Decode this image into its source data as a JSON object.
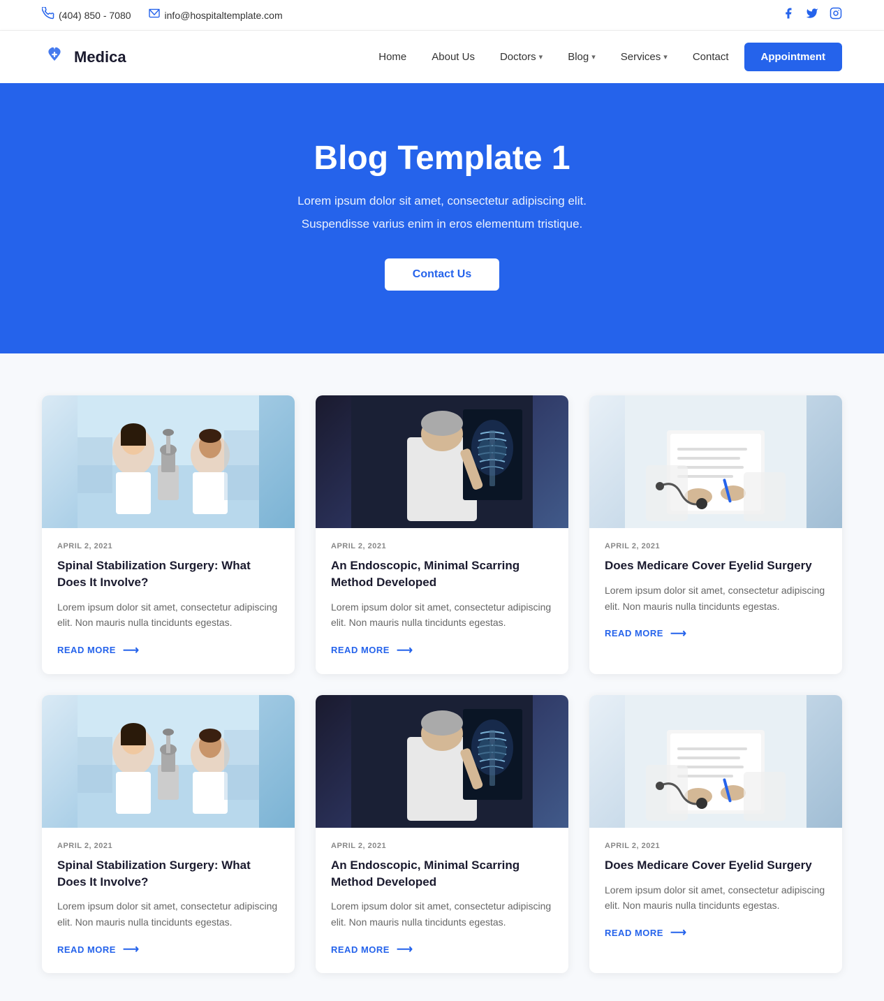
{
  "topbar": {
    "phone": "(404) 850 - 7080",
    "email": "info@hospitaltemplate.com",
    "phone_icon": "☎",
    "email_icon": "✉",
    "social": [
      {
        "name": "facebook",
        "icon": "f"
      },
      {
        "name": "twitter",
        "icon": "t"
      },
      {
        "name": "instagram",
        "icon": "ig"
      }
    ]
  },
  "header": {
    "logo_text": "Medica",
    "nav": [
      {
        "label": "Home",
        "has_dropdown": false
      },
      {
        "label": "About Us",
        "has_dropdown": false
      },
      {
        "label": "Doctors",
        "has_dropdown": true
      },
      {
        "label": "Blog",
        "has_dropdown": true
      },
      {
        "label": "Services",
        "has_dropdown": true
      },
      {
        "label": "Contact",
        "has_dropdown": false
      }
    ],
    "appointment_label": "Appointment"
  },
  "hero": {
    "title": "Blog Template 1",
    "subtitle1": "Lorem ipsum dolor sit amet, consectetur adipiscing elit.",
    "subtitle2": "Suspendisse varius enim in eros elementum tristique.",
    "cta_label": "Contact Us"
  },
  "blog": {
    "posts": [
      {
        "date": "APRIL 2, 2021",
        "title": "Spinal Stabilization Surgery: What Does It Involve?",
        "excerpt": "Lorem ipsum dolor sit amet, consectetur adipiscing elit. Non mauris nulla tincidunts egestas.",
        "read_more": "READ MORE",
        "image_type": "lab"
      },
      {
        "date": "APRIL 2, 2021",
        "title": "An Endoscopic, Minimal Scarring Method Developed",
        "excerpt": "Lorem ipsum dolor sit amet, consectetur adipiscing elit. Non mauris nulla tincidunts egestas.",
        "read_more": "READ MORE",
        "image_type": "xray"
      },
      {
        "date": "APRIL 2, 2021",
        "title": "Does Medicare Cover Eyelid Surgery",
        "excerpt": "Lorem ipsum dolor sit amet, consectetur adipiscing elit. Non mauris nulla tincidunts egestas.",
        "read_more": "READ MORE",
        "image_type": "doctor"
      },
      {
        "date": "APRIL 2, 2021",
        "title": "Spinal Stabilization Surgery: What Does It Involve?",
        "excerpt": "Lorem ipsum dolor sit amet, consectetur adipiscing elit. Non mauris nulla tincidunts egestas.",
        "read_more": "READ MORE",
        "image_type": "lab"
      },
      {
        "date": "APRIL 2, 2021",
        "title": "An Endoscopic, Minimal Scarring Method Developed",
        "excerpt": "Lorem ipsum dolor sit amet, consectetur adipiscing elit. Non mauris nulla tincidunts egestas.",
        "read_more": "READ MORE",
        "image_type": "xray"
      },
      {
        "date": "APRIL 2, 2021",
        "title": "Does Medicare Cover Eyelid Surgery",
        "excerpt": "Lorem ipsum dolor sit amet, consectetur adipiscing elit. Non mauris nulla tincidunts egestas.",
        "read_more": "READ MORE",
        "image_type": "doctor"
      }
    ]
  }
}
